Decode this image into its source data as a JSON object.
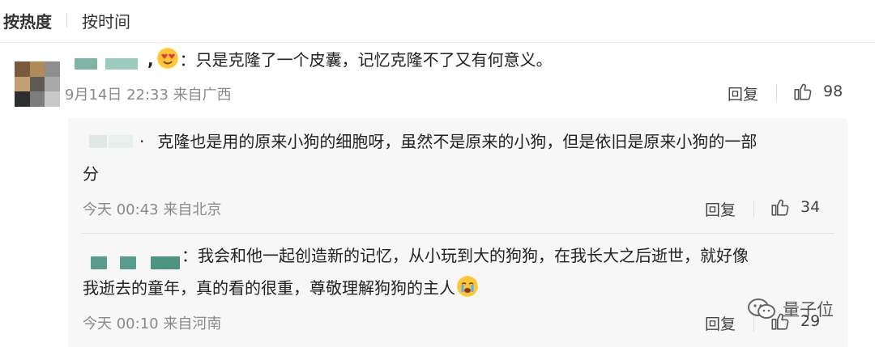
{
  "sort": {
    "hot": "按热度",
    "time": "按时间"
  },
  "comment": {
    "text": "：只是克隆了一个皮囊，记忆克隆不了又有何意义。",
    "date": "9月14日 22:33 来自广西",
    "reply_label": "回复",
    "likes": "98"
  },
  "replies": [
    {
      "text_line1": "克隆也是用的原来小狗的细胞呀，虽然不是原来的小狗，但是依旧是原来小狗的一部",
      "text_line2": "分",
      "date": "今天 00:43 来自北京",
      "reply_label": "回复",
      "likes": "34"
    },
    {
      "text_line1": "：我会和他一起创造新的记忆，从小玩到大的狗狗，在我长大之后逝世，就好像",
      "text_line2": "我逝去的童年，真的看的很重，尊敬理解狗狗的主人",
      "date": "今天 00:10 来自河南",
      "reply_label": "回复",
      "likes": "29"
    }
  ],
  "watermark": {
    "text": "量子位"
  },
  "colors": {
    "redact_teal": "#5a9c8c",
    "background_reply": "#f7f7f7"
  }
}
